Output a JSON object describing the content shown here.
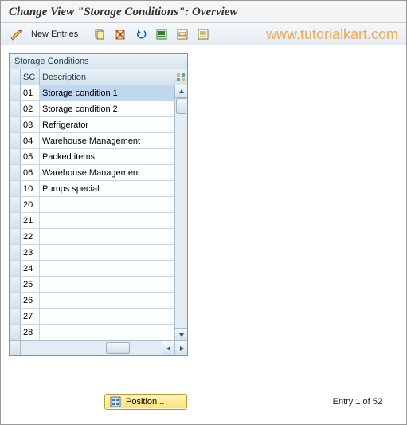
{
  "title": "Change View \"Storage Conditions\": Overview",
  "watermark": "www.tutorialkart.com",
  "toolbar": {
    "new_entries": "New Entries"
  },
  "grid": {
    "title": "Storage Conditions",
    "col_sc": "SC",
    "col_desc": "Description",
    "rows": [
      {
        "sc": "01",
        "desc": "Storage condition 1"
      },
      {
        "sc": "02",
        "desc": "Storage condition 2"
      },
      {
        "sc": "03",
        "desc": "Refrigerator"
      },
      {
        "sc": "04",
        "desc": "Warehouse Management"
      },
      {
        "sc": "05",
        "desc": "Packed items"
      },
      {
        "sc": "06",
        "desc": "Warehouse Management"
      },
      {
        "sc": "10",
        "desc": "Pumps special"
      },
      {
        "sc": "20",
        "desc": ""
      },
      {
        "sc": "21",
        "desc": ""
      },
      {
        "sc": "22",
        "desc": ""
      },
      {
        "sc": "23",
        "desc": ""
      },
      {
        "sc": "24",
        "desc": ""
      },
      {
        "sc": "25",
        "desc": ""
      },
      {
        "sc": "26",
        "desc": ""
      },
      {
        "sc": "27",
        "desc": ""
      },
      {
        "sc": "28",
        "desc": ""
      }
    ],
    "selected_index": 0
  },
  "footer": {
    "position_label": "Position...",
    "entry_text": "Entry 1 of 52"
  }
}
